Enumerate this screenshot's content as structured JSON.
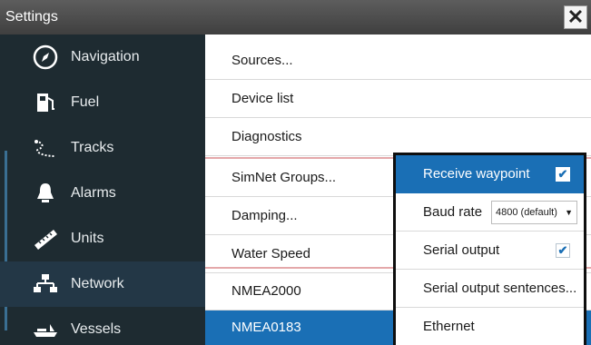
{
  "window": {
    "title": "Settings",
    "close_icon": "close-icon"
  },
  "sidebar": {
    "items": [
      {
        "label": "Navigation",
        "icon": "compass-icon",
        "selected": false
      },
      {
        "label": "Fuel",
        "icon": "fuel-pump-icon",
        "selected": false
      },
      {
        "label": "Tracks",
        "icon": "tracks-icon",
        "selected": false
      },
      {
        "label": "Alarms",
        "icon": "bell-icon",
        "selected": false
      },
      {
        "label": "Units",
        "icon": "ruler-icon",
        "selected": false
      },
      {
        "label": "Network",
        "icon": "network-icon",
        "selected": true
      },
      {
        "label": "Vessels",
        "icon": "vessels-icon",
        "selected": false
      }
    ]
  },
  "network_menu": {
    "items": [
      {
        "label": "Sources...",
        "selected": false
      },
      {
        "label": "Device list",
        "selected": false
      },
      {
        "label": "Diagnostics",
        "selected": false
      },
      {
        "label": "SimNet Groups...",
        "selected": false
      },
      {
        "label": "Damping...",
        "selected": false
      },
      {
        "label": "Water Speed",
        "selected": false
      },
      {
        "label": "NMEA2000",
        "selected": false
      },
      {
        "label": "NMEA0183",
        "selected": true
      }
    ]
  },
  "nmea0183_popup": {
    "receive_waypoint": {
      "label": "Receive waypoint",
      "checked": true,
      "check_glyph": "✔"
    },
    "baud_rate": {
      "label": "Baud rate",
      "value": "4800 (default)",
      "arrow": "▼"
    },
    "serial_output": {
      "label": "Serial output",
      "checked": true,
      "check_glyph": "✔"
    },
    "serial_output_sentences": {
      "label": "Serial output sentences..."
    },
    "ethernet": {
      "label": "Ethernet"
    }
  },
  "colors": {
    "title_bar": "#4a4a4a",
    "sidebar_bg": "#1e2b31",
    "selection_blue": "#1a6fb5",
    "separator_pink": "#e4a8aa"
  }
}
